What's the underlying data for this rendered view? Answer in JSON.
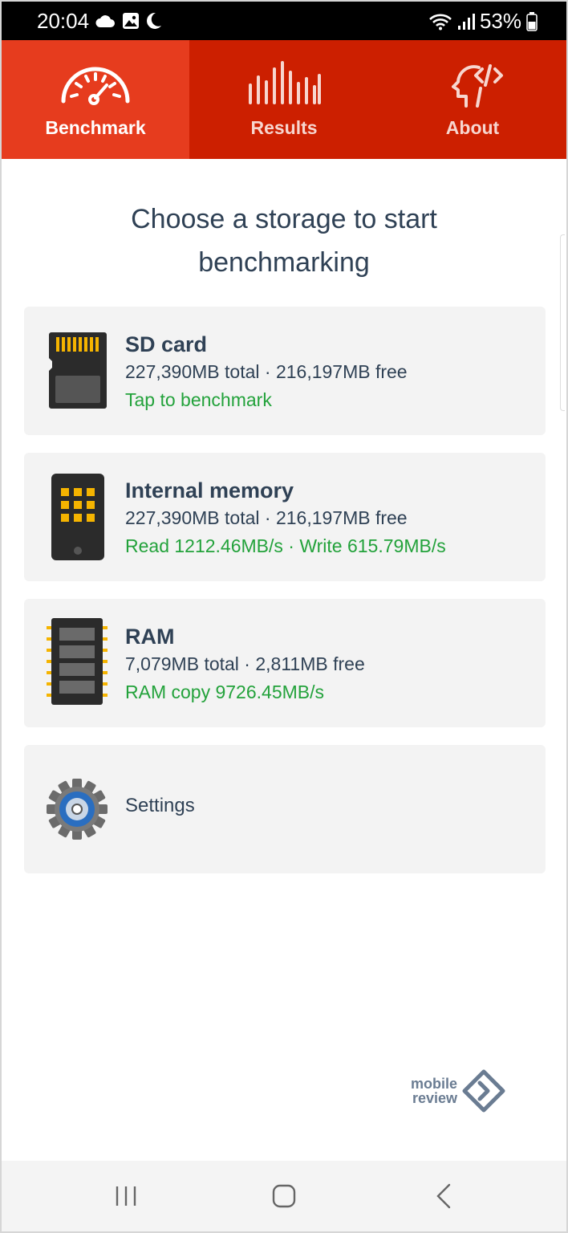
{
  "status_bar": {
    "time": "20:04",
    "battery": "53%",
    "left_icons": [
      "cloud-icon",
      "image-icon",
      "moon-icon"
    ],
    "right_icons": [
      "wifi-icon",
      "signal-icon",
      "battery-icon"
    ]
  },
  "tabs": [
    {
      "label": "Benchmark",
      "icon": "speedometer-icon",
      "active": true
    },
    {
      "label": "Results",
      "icon": "bars-icon",
      "active": false
    },
    {
      "label": "About",
      "icon": "head-code-icon",
      "active": false
    }
  ],
  "heading": "Choose a storage to start benchmarking",
  "cards": {
    "sd_card": {
      "title": "SD card",
      "sub": "227,390MB total · 216,197MB free",
      "status": "Tap to benchmark"
    },
    "internal": {
      "title": "Internal memory",
      "sub": "227,390MB total · 216,197MB free",
      "status": "Read 1212.46MB/s · Write 615.79MB/s"
    },
    "ram": {
      "title": "RAM",
      "sub": "7,079MB total · 2,811MB free",
      "status": "RAM copy 9726.45MB/s"
    },
    "settings": {
      "label": "Settings"
    }
  },
  "watermark": {
    "line1": "mobile",
    "line2": "review"
  },
  "colors": {
    "tab_bar": "#cc1f00",
    "tab_active": "#e63c1e",
    "text_dark": "#2f4155",
    "status_green": "#23a23b",
    "card_bg": "#f3f3f3"
  }
}
